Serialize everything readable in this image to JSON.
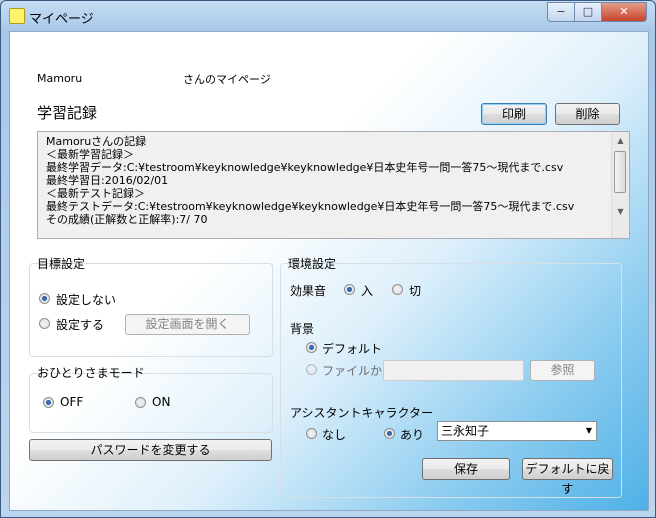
{
  "window": {
    "title": "マイページ",
    "minimize": "−",
    "maximize": "□",
    "close": "✕"
  },
  "header": {
    "user_name": "Mamoru",
    "greeting": "さんのマイページ",
    "section_title": "学習記録"
  },
  "toolbar": {
    "print_label": "印刷",
    "delete_label": "削除"
  },
  "record_lines": [
    "Mamoruさんの記録",
    "＜最新学習記録＞",
    "最終学習データ:C:¥testroom¥keyknowledge¥keyknowledge¥日本史年号一問一答75〜現代まで.csv",
    "最終学習日:2016/02/01",
    "＜最新テスト記録＞",
    "最終テストデータ:C:¥testroom¥keyknowledge¥keyknowledge¥日本史年号一問一答75〜現代まで.csv",
    "その成績(正解数と正解率):7/ 70"
  ],
  "goal": {
    "title": "目標設定",
    "no_goal_label": "設定しない",
    "set_goal_label": "設定する",
    "open_settings_label": "設定画面を開く",
    "selected": "設定しない"
  },
  "solo": {
    "title": "おひとりさまモード",
    "off_label": "OFF",
    "on_label": "ON",
    "selected": "OFF"
  },
  "password_button": "パスワードを変更する",
  "env": {
    "title": "環境設定",
    "sound_label": "効果音",
    "sound_on": "入",
    "sound_off": "切",
    "sound_selected": "入",
    "background_label": "背景",
    "bg_default": "デフォルト",
    "bg_file": "ファイルから",
    "bg_selected": "デフォルト",
    "bg_file_value": "",
    "browse_label": "参照",
    "assistant_label": "アシスタントキャラクター",
    "assistant_none": "なし",
    "assistant_yes": "あり",
    "assistant_selected": "あり",
    "assistant_character": "三永知子",
    "save_label": "保存",
    "reset_label": "デフォルトに戻す"
  },
  "icons": {
    "app": "notepad-icon",
    "dropdown": "chevron-down-icon",
    "scroll_up": "scroll-up-icon",
    "scroll_down": "scroll-down-icon"
  }
}
